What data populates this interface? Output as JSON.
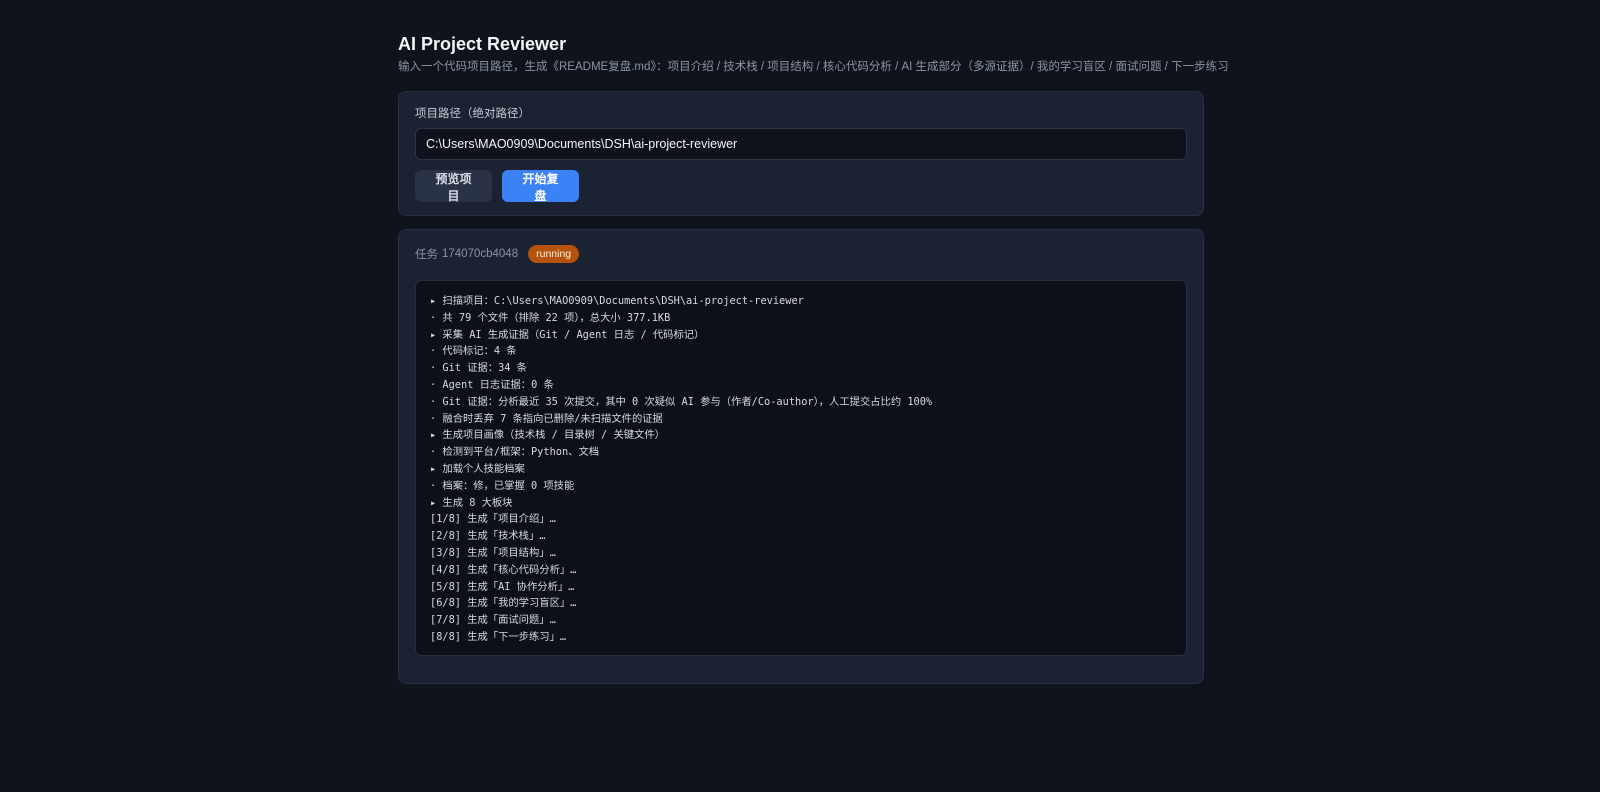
{
  "header": {
    "title": "AI Project Reviewer",
    "subtitle": "输入一个代码项目路径，生成《README复盘.md》：项目介绍 / 技术栈 / 项目结构 / 核心代码分析 / AI 生成部分（多源证据）/ 我的学习盲区 / 面试问题 / 下一步练习"
  },
  "form": {
    "path_label": "项目路径（绝对路径）",
    "path_value": "C:\\Users\\MAO0909\\Documents\\DSH\\ai-project-reviewer",
    "preview_button": "预览项目",
    "start_button": "开始复盘"
  },
  "task": {
    "label": "任务",
    "id": "174070cb4048",
    "status": "running",
    "status_color": "#b45309",
    "log_lines": [
      "▸ 扫描项目：C:\\Users\\MAO0909\\Documents\\DSH\\ai-project-reviewer",
      "· 共 79 个文件（排除 22 项），总大小 377.1KB",
      "▸ 采集 AI 生成证据（Git / Agent 日志 / 代码标记）",
      "· 代码标记：4 条",
      "· Git 证据：34 条",
      "· Agent 日志证据：0 条",
      "· Git 证据：分析最近 35 次提交，其中 0 次疑似 AI 参与（作者/Co-author），人工提交占比约 100%",
      "· 融合时丢弃 7 条指向已删除/未扫描文件的证据",
      "▸ 生成项目画像（技术栈 / 目录树 / 关键文件）",
      "· 检测到平台/框架：Python、文档",
      "▸ 加载个人技能档案",
      "· 档案：修，已掌握 0 项技能",
      "▸ 生成 8 大板块",
      "[1/8] 生成「项目介绍」…",
      "[2/8] 生成「技术栈」…",
      "[3/8] 生成「项目结构」…",
      "[4/8] 生成「核心代码分析」…",
      "[5/8] 生成「AI 协作分析」…",
      "[6/8] 生成「我的学习盲区」…",
      "[7/8] 生成「面试问题」…",
      "[8/8] 生成「下一步练习」…"
    ]
  },
  "colors": {
    "background": "#0f131c",
    "card": "#1b2232",
    "primary": "#3b82f6",
    "running": "#b45309"
  }
}
